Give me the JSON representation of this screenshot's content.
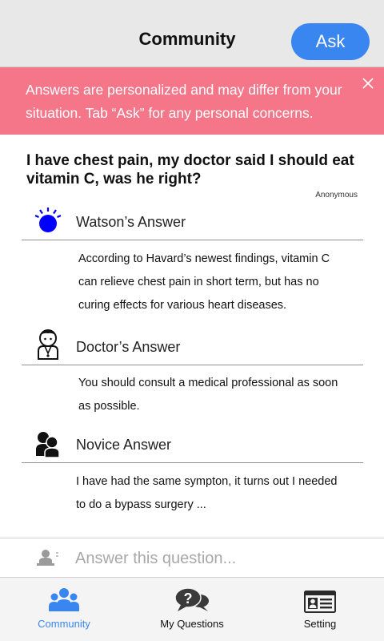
{
  "header": {
    "title": "Community",
    "ask_label": "Ask"
  },
  "banner": {
    "text": "Answers are personalized and may differ from your situation. Tab “Ask” for any personal concerns."
  },
  "question": {
    "title": "I have chest pain, my doctor said I should eat vitamin C, was he right?",
    "author": "Anonymous"
  },
  "answers": [
    {
      "label": "Watson’s Answer",
      "icon": "watson-icon",
      "text": "According to Havard’s newest findings, vitamin C can relieve chest pain in short term, but has no curing effects for various heart diseases."
    },
    {
      "label": "Doctor’s Answer",
      "icon": "doctor-icon",
      "text": "You should consult a medical professional as soon as possible."
    },
    {
      "label": "Novice Answer",
      "icon": "users-icon",
      "text": "I have had the same sympton, it turns out I needed to do a bypass surgery ..."
    }
  ],
  "answer_input": {
    "placeholder": "Answer this question..."
  },
  "tabs": [
    {
      "label": "Community",
      "icon": "community-icon",
      "active": true
    },
    {
      "label": "My Questions",
      "icon": "question-bubble-icon",
      "active": false
    },
    {
      "label": "Setting",
      "icon": "id-card-icon",
      "active": false
    }
  ],
  "colors": {
    "accent": "#3a86f1",
    "banner": "#f57688",
    "header_bg": "#e8e8e8",
    "watson_blue": "#0000ff"
  }
}
